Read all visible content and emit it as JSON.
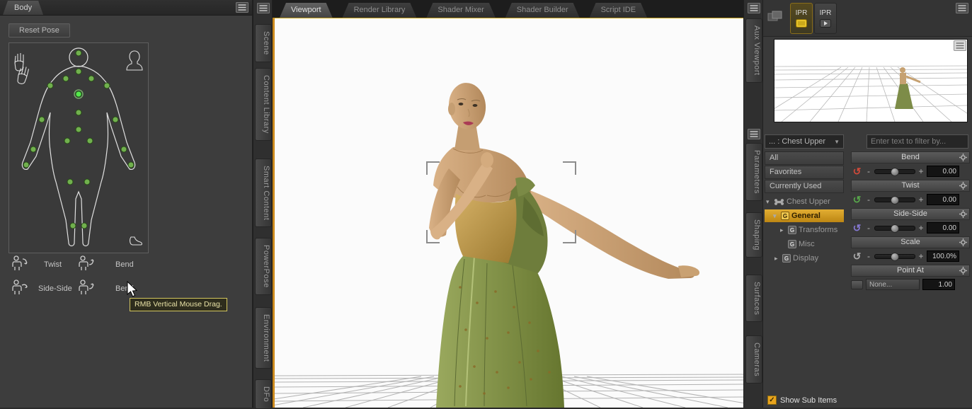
{
  "icons": {
    "dropdown_arrow": "▼",
    "tree_expanded": "▾",
    "tree_collapsed": "▸",
    "dial_glyph": "↺",
    "check_glyph": "✓",
    "group_glyph": "G",
    "minus_glyph": "-",
    "plus_glyph": "+"
  },
  "left_panel": {
    "tab_label": "Body",
    "reset_pose_button": "Reset Pose",
    "tool_twist": "Twist",
    "tool_bend": "Bend",
    "tool_side_side": "Side-Side",
    "tool_bend_2": "Bend",
    "tooltip": "RMB Vertical Mouse Drag."
  },
  "left_dock_tabs": [
    {
      "label": "Scene"
    },
    {
      "label": "Content Library"
    },
    {
      "label": "Smart Content"
    },
    {
      "label": "PowerPose"
    },
    {
      "label": "Environment"
    },
    {
      "label": "DFo"
    }
  ],
  "viewport_tabs": [
    {
      "label": "Viewport"
    },
    {
      "label": "Render Library"
    },
    {
      "label": "Shader Mixer"
    },
    {
      "label": "Shader Builder"
    },
    {
      "label": "Script IDE"
    }
  ],
  "right_dock_tabs": [
    {
      "label": "Aux Viewport"
    },
    {
      "label": "Parameters"
    },
    {
      "label": "Shaping"
    },
    {
      "label": "Surfaces"
    },
    {
      "label": "Cameras"
    }
  ],
  "aux_viewport": {
    "ipr_button_1": "IPR",
    "ipr_button_2": "IPR"
  },
  "parameters": {
    "node_selector": "... : Chest Upper",
    "filter_placeholder": "Enter text to filter by...",
    "list": [
      {
        "label": "All"
      },
      {
        "label": "Favorites"
      },
      {
        "label": "Currently Used"
      }
    ],
    "tree": {
      "root": "Chest Upper",
      "general": "General",
      "transforms": "Transforms",
      "misc": "Misc",
      "display": "Display"
    },
    "sliders": [
      {
        "label": "Bend",
        "value": "0.00"
      },
      {
        "label": "Twist",
        "value": "0.00"
      },
      {
        "label": "Side-Side",
        "value": "0.00"
      },
      {
        "label": "Scale",
        "value": "100.0%"
      }
    ],
    "point_at": {
      "label": "Point At",
      "target": "None...",
      "value": "1.00"
    },
    "show_sub_items_label": "Show Sub Items"
  }
}
